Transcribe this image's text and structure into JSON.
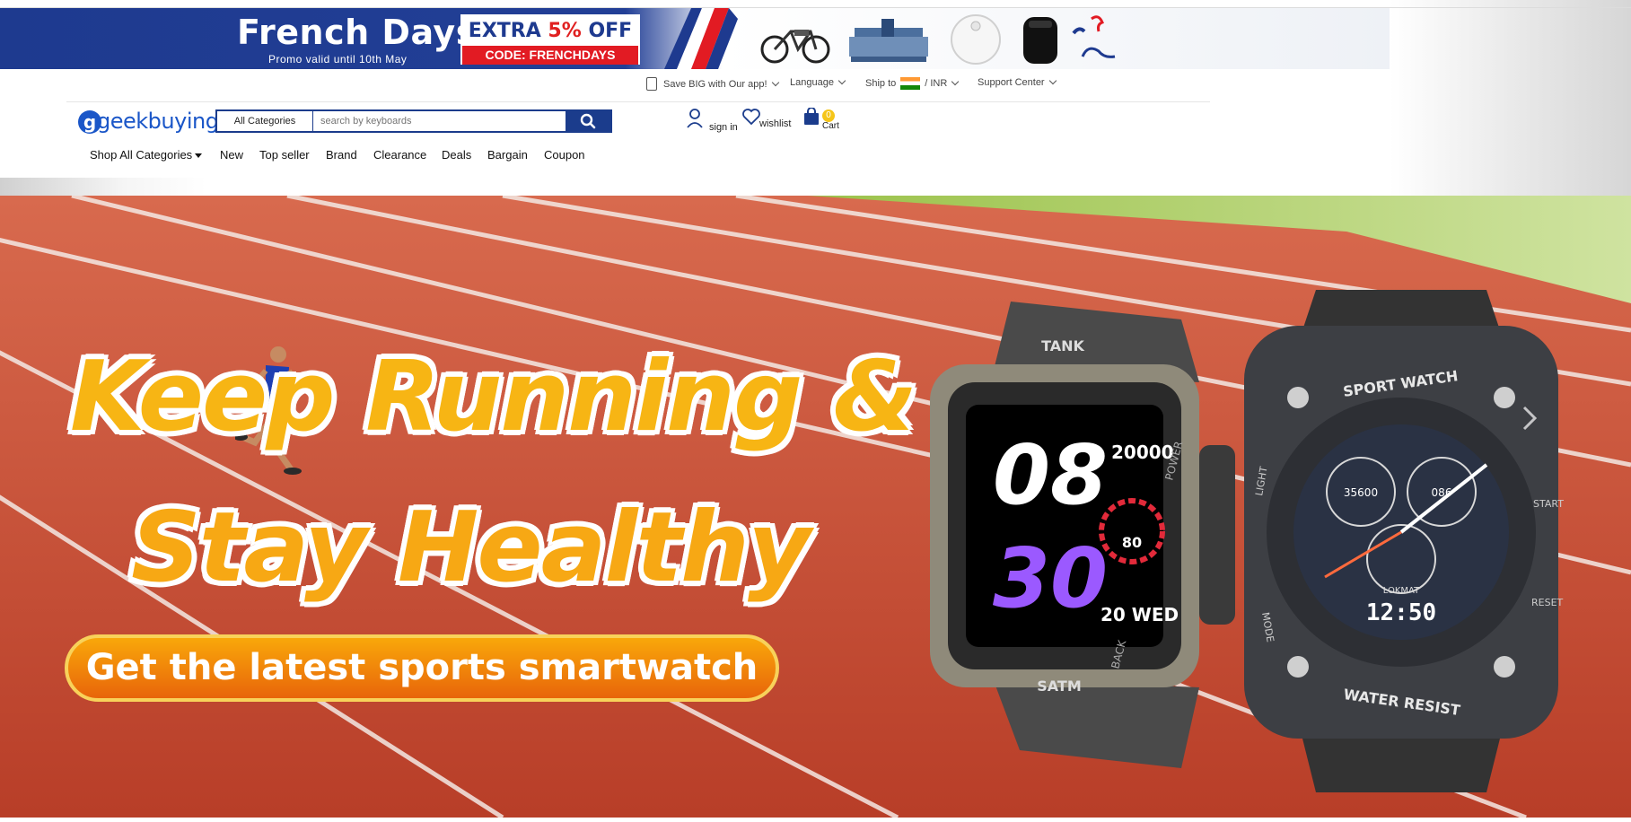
{
  "promo": {
    "title": "French Days",
    "subtitle": "Promo valid until 10th May",
    "offer_prefix": "EXTRA ",
    "offer_percent": "5%",
    "offer_suffix": " OFF",
    "code": "CODE: FRENCHDAYS"
  },
  "utility": {
    "app": "Save BIG with Our app!",
    "language": "Language",
    "ship_to": "Ship to",
    "currency": "/ INR",
    "support": "Support Center"
  },
  "header": {
    "logo": "geekbuying",
    "search_category": "All Categories",
    "search_placeholder": "search by keyboards",
    "sign_in": "sign in",
    "wishlist": "wishlist",
    "cart": "Cart",
    "cart_count": "0"
  },
  "nav": {
    "shop_all": "Shop All Categories",
    "items": [
      "New",
      "Top seller",
      "Brand",
      "Clearance",
      "Deals",
      "Bargain",
      "Coupon"
    ]
  },
  "hero": {
    "line1": "Keep Running &",
    "line2": "Stay Healthy",
    "cta": "Get the latest sports smartwatch",
    "watch1": {
      "brand": "TANK",
      "hour": "08",
      "minute": "30",
      "steps": "20000",
      "heart": "80",
      "date": "20 WED",
      "bottom": "SATM",
      "side": "POWER",
      "back": "BACK"
    },
    "watch2": {
      "top": "SPORT WATCH",
      "bottom": "WATER RESIST",
      "time": "12:50",
      "steps": "35600",
      "hr": "086",
      "brand": "LOKMAT",
      "light": "LIGHT",
      "mode": "MODE",
      "start": "START",
      "reset": "RESET"
    }
  },
  "colors": {
    "brand_blue": "#1b3c8c",
    "track_red": "#c9452c",
    "accent_orange": "#f7a814"
  }
}
